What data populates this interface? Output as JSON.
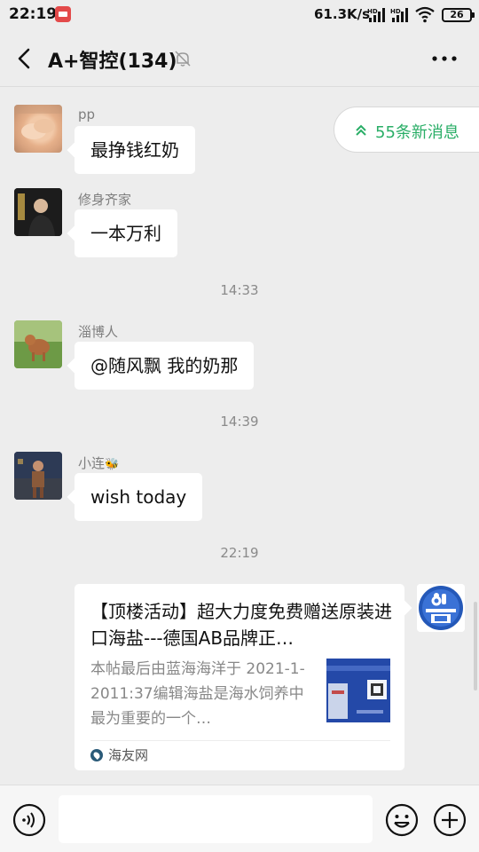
{
  "status_bar": {
    "time": "22:19",
    "network_speed": "61.3K/s",
    "battery": "26",
    "icons": [
      "app-notification-icon",
      "signal-hd-icon",
      "signal-hd-icon",
      "wifi-icon",
      "battery-icon"
    ]
  },
  "header": {
    "title": "A+智控(134)",
    "icons": [
      "back-arrow-icon",
      "mute-bell-icon",
      "more-dots-icon"
    ]
  },
  "new_messages": {
    "label": "55条新消息",
    "icon": "double-chevron-up-icon",
    "accent": "#2aae67"
  },
  "messages": [
    {
      "sender": "pp",
      "text": "最挣钱红奶"
    },
    {
      "sender": "修身齐家",
      "text": "一本万利"
    },
    {
      "timestamp": "14:33"
    },
    {
      "sender": "淄博人",
      "text": "@随风飘  我的奶那"
    },
    {
      "timestamp": "14:39"
    },
    {
      "sender": "小连",
      "sender_emoji": "🐝",
      "text": "wish today"
    },
    {
      "timestamp": "22:19"
    }
  ],
  "link_card": {
    "title": "【顶楼活动】超大力度免费赠送原装进口海盐---德国AB品牌正…",
    "description": "本帖最后由蓝海海洋于 2021-1-2011:37编辑海盐是海水饲养中最为重要的一个…",
    "source": "海友网"
  },
  "input_bar": {
    "placeholder": "",
    "icons": [
      "voice-icon",
      "emoji-icon",
      "plus-icon"
    ]
  }
}
